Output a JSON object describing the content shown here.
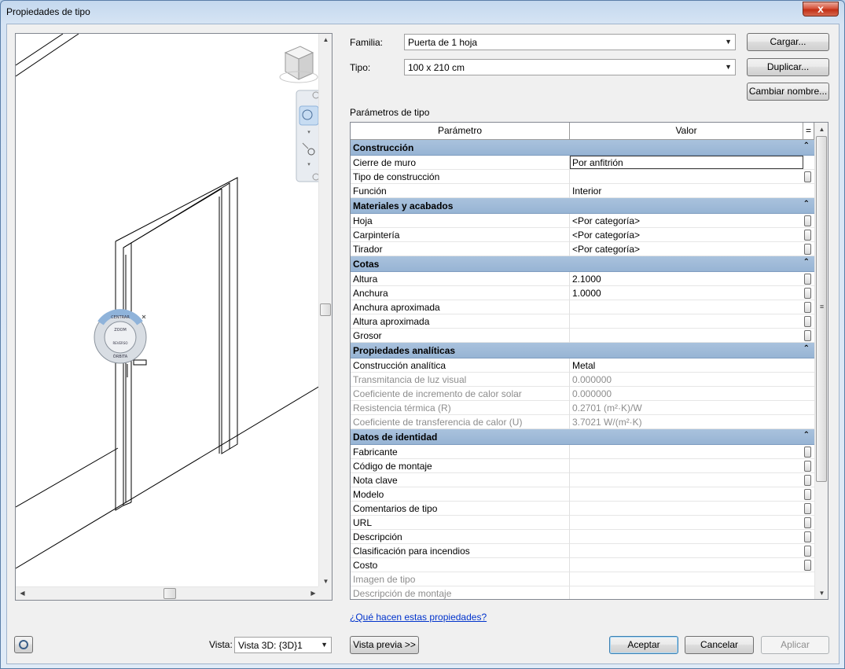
{
  "window": {
    "title": "Propiedades de tipo",
    "close_glyph": "x"
  },
  "family": {
    "label": "Familia:",
    "value": "Puerta de 1 hoja"
  },
  "type": {
    "label": "Tipo:",
    "value": "100 x 210 cm"
  },
  "buttons": {
    "load": "Cargar...",
    "duplicate": "Duplicar...",
    "rename": "Cambiar nombre...",
    "preview": "Vista previa >>",
    "ok": "Aceptar",
    "cancel": "Cancelar",
    "apply": "Aplicar"
  },
  "type_params_label": "Parámetros de tipo",
  "grid": {
    "col_param": "Parámetro",
    "col_value": "Valor",
    "col_eq": "=",
    "groups": [
      {
        "title": "Construcción",
        "rows": [
          {
            "name": "Cierre de muro",
            "value": "Por anfitrión",
            "editing": true,
            "disabled": false,
            "btn": false
          },
          {
            "name": "Tipo de construcción",
            "value": "",
            "disabled": false,
            "btn": true
          },
          {
            "name": "Función",
            "value": "Interior",
            "disabled": false,
            "btn": false
          }
        ]
      },
      {
        "title": "Materiales y acabados",
        "rows": [
          {
            "name": "Hoja",
            "value": "<Por categoría>",
            "disabled": false,
            "btn": true
          },
          {
            "name": "Carpintería",
            "value": "<Por categoría>",
            "disabled": false,
            "btn": true
          },
          {
            "name": "Tirador",
            "value": "<Por categoría>",
            "disabled": false,
            "btn": true
          }
        ]
      },
      {
        "title": "Cotas",
        "rows": [
          {
            "name": "Altura",
            "value": "2.1000",
            "disabled": false,
            "btn": true
          },
          {
            "name": "Anchura",
            "value": "1.0000",
            "disabled": false,
            "btn": true
          },
          {
            "name": "Anchura aproximada",
            "value": "",
            "disabled": false,
            "btn": true
          },
          {
            "name": "Altura aproximada",
            "value": "",
            "disabled": false,
            "btn": true
          },
          {
            "name": "Grosor",
            "value": "",
            "disabled": false,
            "btn": true
          }
        ]
      },
      {
        "title": "Propiedades analíticas",
        "rows": [
          {
            "name": "Construcción analítica",
            "value": "Metal",
            "disabled": false,
            "btn": false
          },
          {
            "name": "Transmitancia de luz visual",
            "value": "0.000000",
            "disabled": true,
            "btn": false
          },
          {
            "name": "Coeficiente de incremento de calor solar",
            "value": "0.000000",
            "disabled": true,
            "btn": false
          },
          {
            "name": "Resistencia térmica (R)",
            "value": "0.2701 (m²·K)/W",
            "disabled": true,
            "btn": false
          },
          {
            "name": "Coeficiente de transferencia de calor (U)",
            "value": "3.7021 W/(m²·K)",
            "disabled": true,
            "btn": false
          }
        ]
      },
      {
        "title": "Datos de identidad",
        "rows": [
          {
            "name": "Fabricante",
            "value": "",
            "disabled": false,
            "btn": true
          },
          {
            "name": "Código de montaje",
            "value": "",
            "disabled": false,
            "btn": true
          },
          {
            "name": "Nota clave",
            "value": "",
            "disabled": false,
            "btn": true
          },
          {
            "name": "Modelo",
            "value": "",
            "disabled": false,
            "btn": true
          },
          {
            "name": "Comentarios de tipo",
            "value": "",
            "disabled": false,
            "btn": true
          },
          {
            "name": "URL",
            "value": "",
            "disabled": false,
            "btn": true
          },
          {
            "name": "Descripción",
            "value": "",
            "disabled": false,
            "btn": true
          },
          {
            "name": "Clasificación para incendios",
            "value": "",
            "disabled": false,
            "btn": true
          },
          {
            "name": "Costo",
            "value": "",
            "disabled": false,
            "btn": true
          },
          {
            "name": "Imagen de tipo",
            "value": "",
            "disabled": true,
            "btn": false
          },
          {
            "name": "Descripción de montaje",
            "value": "",
            "disabled": true,
            "btn": false
          }
        ]
      }
    ]
  },
  "help_link": "¿Qué hacen estas propiedades?",
  "view": {
    "label": "Vista:",
    "value": "Vista 3D: {3D}1"
  },
  "icons": {
    "steering_wheel": "steering-wheel-icon",
    "viewcube": "viewcube-icon",
    "zoom": "zoom-icon",
    "preview_toggle": "steeringwheel-toggle-icon"
  },
  "wheel_labels": {
    "top": "CENTRAR",
    "mid": "ZOOM",
    "lower": "REVERSO",
    "bottom": "ÓRBITA"
  }
}
